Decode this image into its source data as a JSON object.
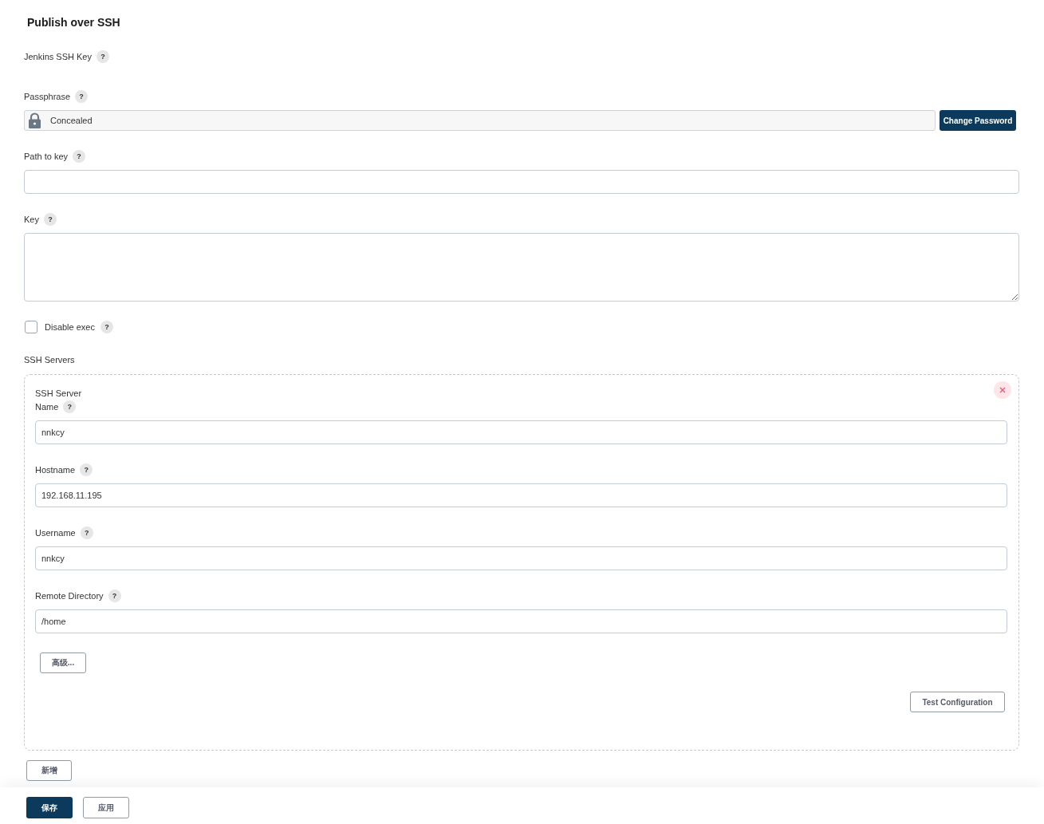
{
  "section": {
    "title": "Publish over SSH"
  },
  "fields": [
    {
      "kind": "label",
      "label": "Jenkins SSH Key",
      "help": "?"
    },
    {
      "kind": "concealed",
      "label": "Passphrase",
      "help": "?",
      "value": "Concealed",
      "button": "Change Password"
    },
    {
      "kind": "text",
      "label": "Path to key",
      "help": "?"
    },
    {
      "kind": "textarea",
      "label": "Key",
      "help": "?"
    },
    {
      "kind": "checkbox",
      "label": "Disable exec",
      "help": "?",
      "checked": false
    }
  ],
  "ssh_servers": {
    "label": "SSH Servers",
    "servers": [
      {
        "heading": "SSH Server",
        "fields": [
          {
            "label": "Name",
            "help": "?",
            "value": "nnkcy"
          },
          {
            "label": "Hostname",
            "help": "?",
            "value": "192.168.11.195"
          },
          {
            "label": "Username",
            "help": "?",
            "value": "nnkcy"
          },
          {
            "label": "Remote Directory",
            "help": "?",
            "value": "/home"
          }
        ],
        "advanced_button": "高级...",
        "test_button": "Test Configuration"
      }
    ],
    "add_button": "新增"
  },
  "footer": {
    "buttons": [
      {
        "label": "保存",
        "primary": true
      },
      {
        "label": "应用",
        "primary": false
      }
    ]
  }
}
